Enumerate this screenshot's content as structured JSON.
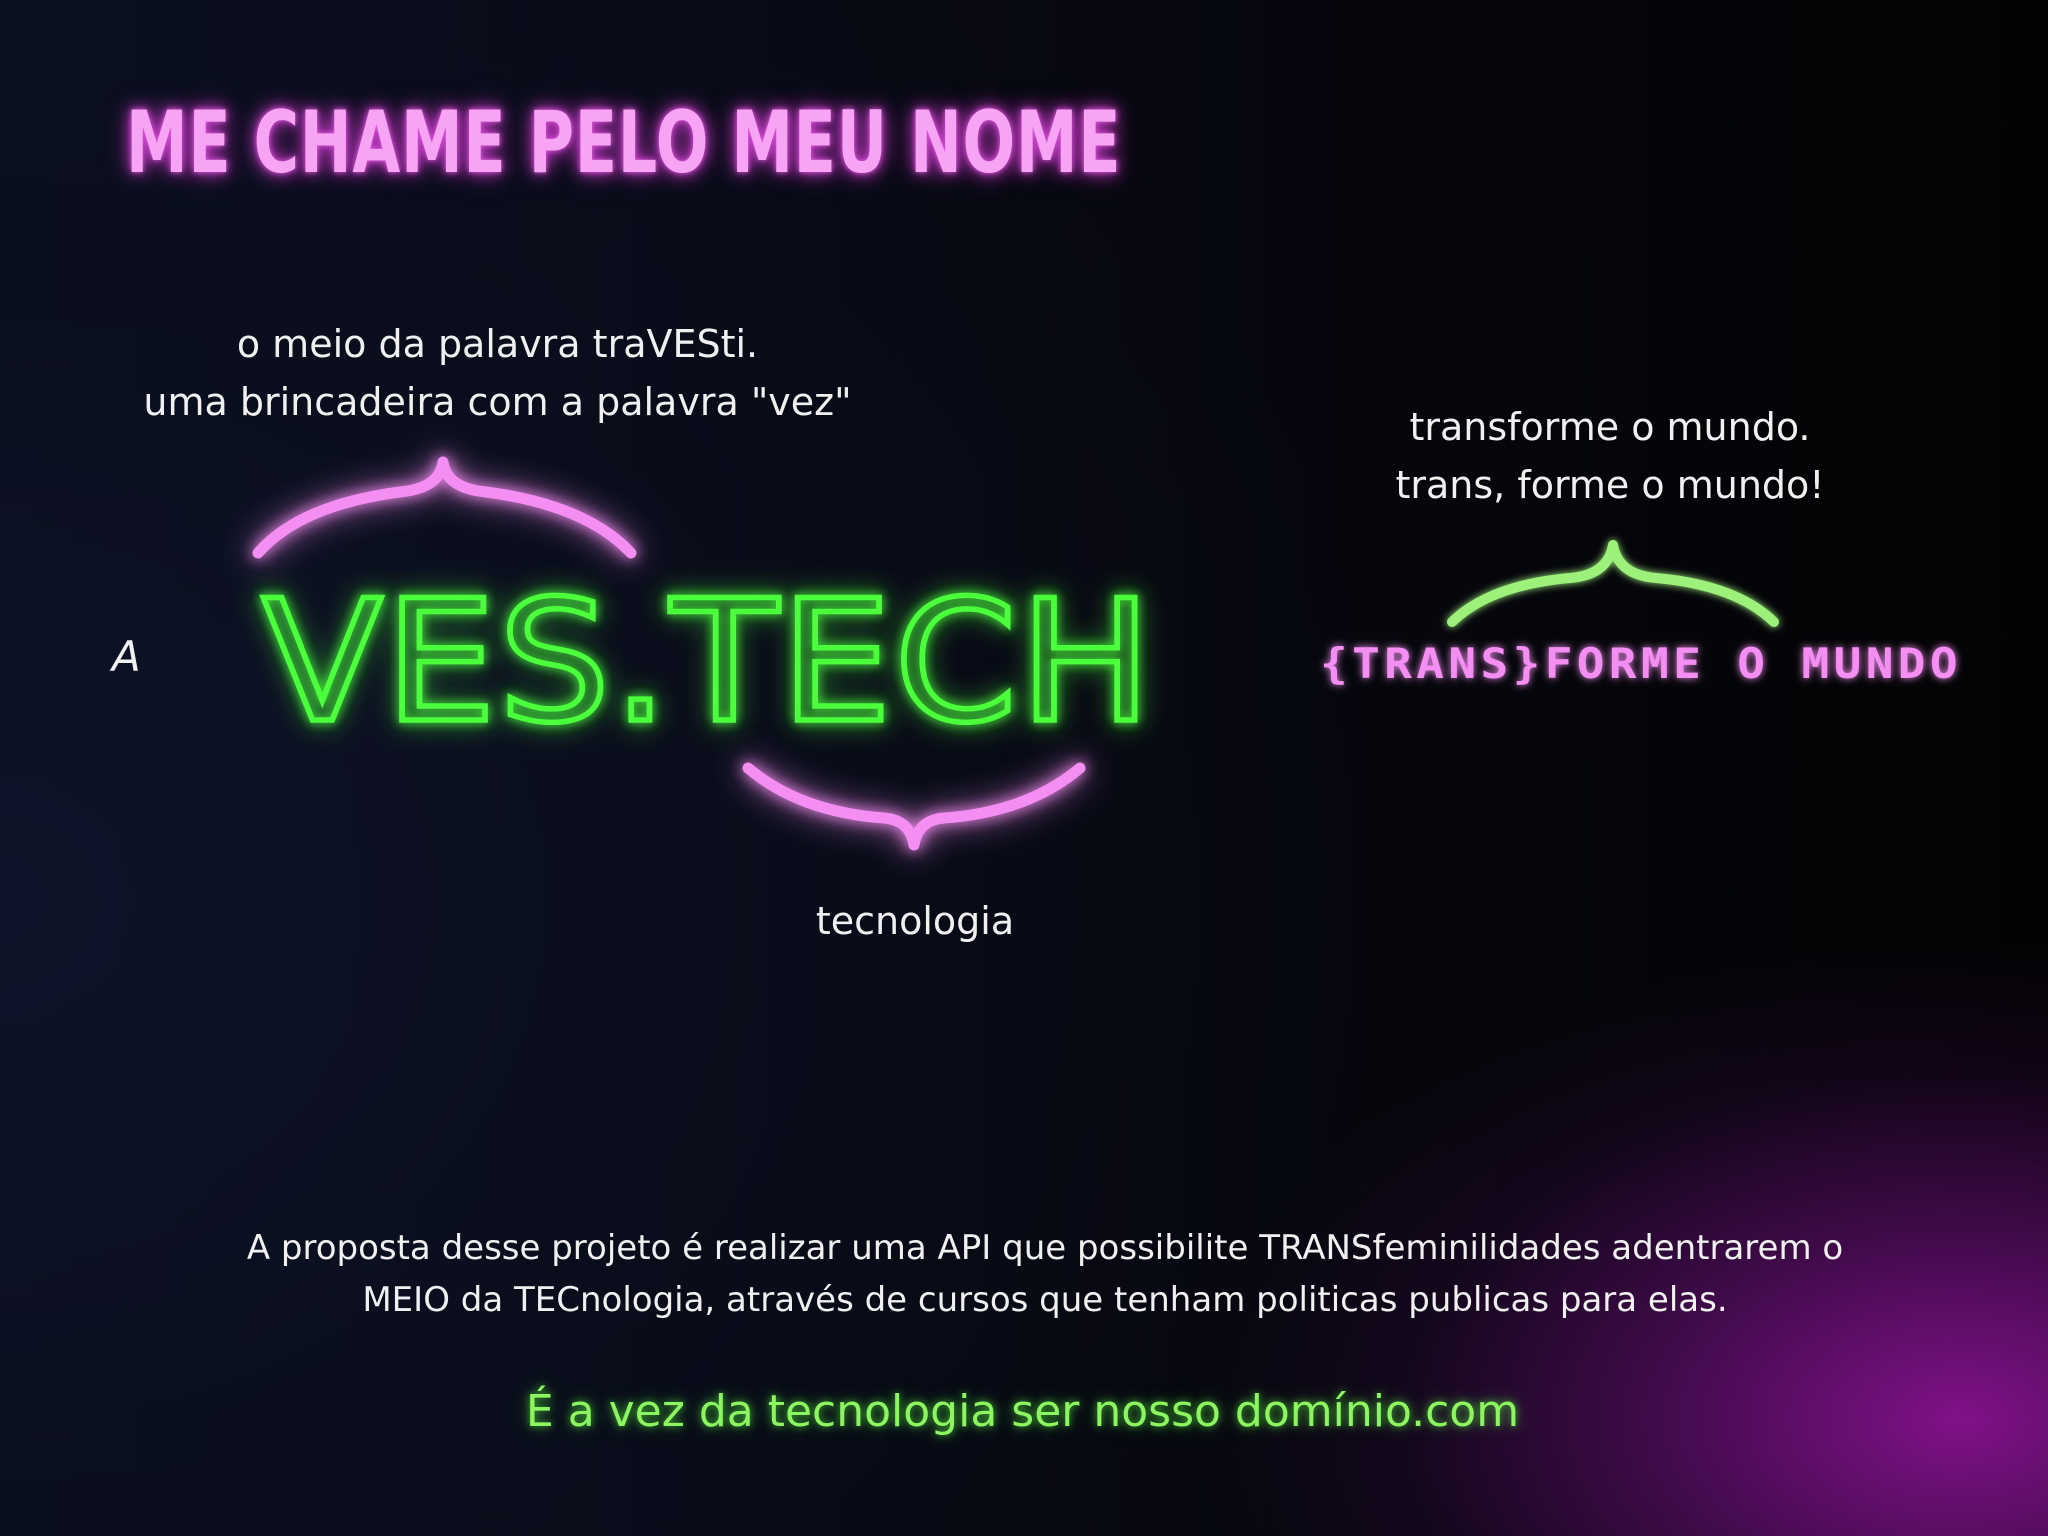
{
  "title": "ME CHAME PELO MEU NOME",
  "captions": {
    "top_left": [
      "o meio da palavra traVESti.",
      "uma brincadeira com a palavra \"vez\""
    ],
    "top_right": [
      "transforme o mundo.",
      "trans, forme o mundo!"
    ],
    "bottom": "tecnologia"
  },
  "prefix_letter": "A",
  "logo": {
    "text": "VES.TECH",
    "tagline": "{TRANS}FORME O MUNDO"
  },
  "description": [
    "A proposta desse projeto é realizar uma API que possibilite TRANSfeminilidades adentrarem o",
    "MEIO da TECnologia, através de cursos que tenham politicas publicas para elas."
  ],
  "slogan": "É a vez da tecnologia ser nosso domínio.com",
  "colors": {
    "neon_pink": "#f48ef2",
    "neon_green": "#4bff3e",
    "slogan_green": "#8df55f",
    "background_dark": "#050608",
    "glow_purple": "#96149f"
  },
  "icons": [
    "curly-brace-icon"
  ]
}
